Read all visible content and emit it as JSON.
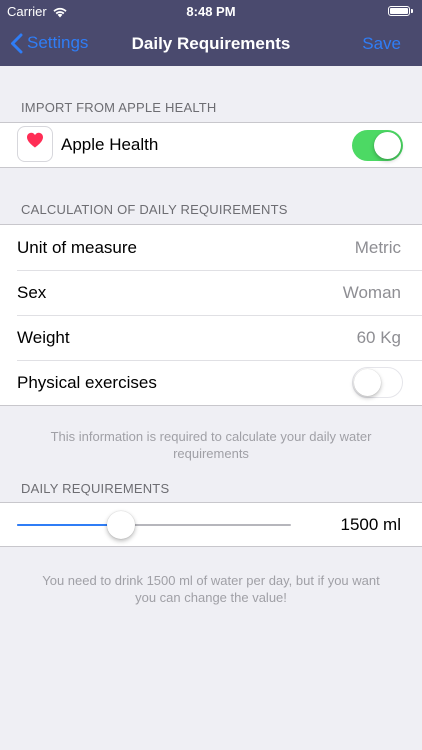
{
  "status_bar": {
    "carrier": "Carrier",
    "time": "8:48 PM"
  },
  "nav": {
    "back_label": "Settings",
    "title": "Daily Requirements",
    "save_label": "Save"
  },
  "import_section": {
    "header": "IMPORT FROM APPLE HEALTH",
    "apple_health_label": "Apple Health",
    "apple_health_enabled": true
  },
  "calc_section": {
    "header": "CALCULATION OF DAILY REQUIREMENTS",
    "rows": [
      {
        "label": "Unit of measure",
        "value": "Metric"
      },
      {
        "label": "Sex",
        "value": "Woman"
      },
      {
        "label": "Weight",
        "value": "60 Kg"
      }
    ],
    "physical_label": "Physical exercises",
    "physical_enabled": false,
    "footer": "This information is required to calculate your daily water requirements"
  },
  "daily_section": {
    "header": "DAILY REQUIREMENTS",
    "slider_fraction": 0.38,
    "value_label": "1500 ml",
    "footer": "You need to drink 1500 ml of water per day, but if you want you can change the value!"
  },
  "colors": {
    "nav_background": "#4a4a6e",
    "accent": "#2f7df6",
    "toggle_on": "#4cd964",
    "heart": "#ff2d55"
  },
  "icons": [
    "wifi-icon",
    "battery-icon",
    "chevron-left-icon",
    "heart-icon"
  ]
}
